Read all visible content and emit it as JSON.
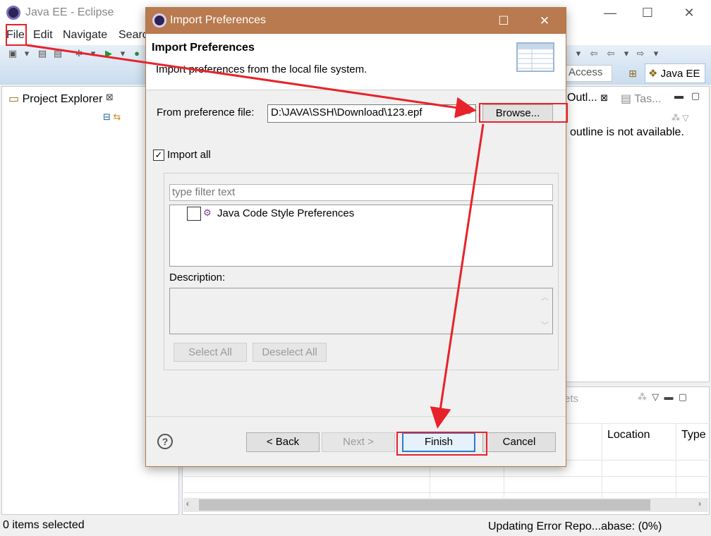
{
  "app": {
    "window_title": "Java EE - Eclipse",
    "menu": [
      "File",
      "Edit",
      "Navigate",
      "Searc"
    ],
    "quick_access": "Access",
    "perspective": "Java EE"
  },
  "project_explorer": {
    "tab_label": "Project Explorer",
    "close_glyph": "⊠"
  },
  "outline": {
    "tab_label": "Outl...",
    "tasks_tab": "Tas...",
    "message": "outline is not available."
  },
  "bottom_panel": {
    "tab_label": "ets",
    "columns": [
      "Location",
      "Type"
    ]
  },
  "status": {
    "left": "0 items selected",
    "right": "Updating Error Repo...abase: (0%)"
  },
  "dialog": {
    "title": "Import Preferences",
    "heading": "Import Preferences",
    "description": "Import preferences from the local file system.",
    "from_label": "From preference file:",
    "file_value": "D:\\JAVA\\SSH\\Download\\123.epf",
    "browse_label": "Browse...",
    "import_all_label": "Import all",
    "import_all_checked": true,
    "filter_placeholder": "type filter text",
    "tree_items": [
      {
        "label": "Java Code Style Preferences",
        "checked": false
      }
    ],
    "description_label": "Description:",
    "select_all_label": "Select All",
    "deselect_all_label": "Deselect All",
    "back_label": "< Back",
    "next_label": "Next >",
    "finish_label": "Finish",
    "cancel_label": "Cancel",
    "help_glyph": "?"
  },
  "annotation_color": "#e8222a"
}
